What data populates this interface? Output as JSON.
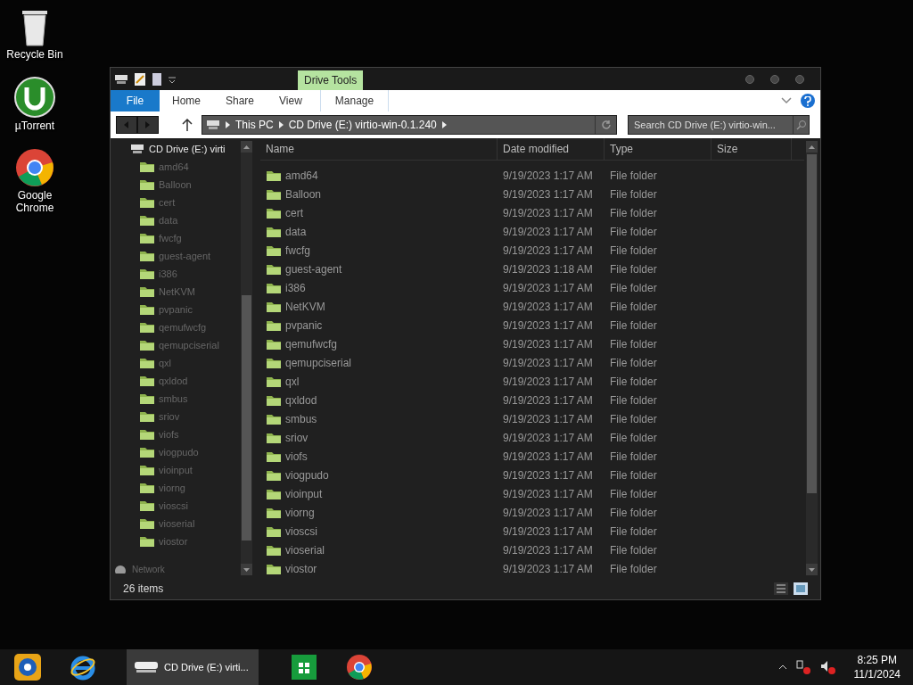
{
  "desktop_icons": [
    {
      "kind": "bin",
      "label": "Recycle Bin"
    },
    {
      "kind": "utorrent",
      "label": "µTorrent"
    },
    {
      "kind": "chrome",
      "label": "Google Chrome"
    }
  ],
  "window": {
    "ribbon_context": "Drive Tools",
    "tabs": [
      {
        "label": "File",
        "selected": false,
        "kind": "file"
      },
      {
        "label": "Home",
        "selected": false,
        "kind": "tab"
      },
      {
        "label": "Share",
        "selected": false,
        "kind": "tab"
      },
      {
        "label": "View",
        "selected": false,
        "kind": "tab"
      },
      {
        "label": "Manage",
        "selected": false,
        "kind": "context"
      }
    ],
    "breadcrumb": [
      "This PC",
      "CD Drive (E:) virtio-win-0.1.240"
    ],
    "search": {
      "placeholder": "Search CD Drive (E:) virtio-win..."
    },
    "nav": {
      "root": "CD Drive (E:) virti",
      "children": [
        "amd64",
        "Balloon",
        "cert",
        "data",
        "fwcfg",
        "guest-agent",
        "i386",
        "NetKVM",
        "pvpanic",
        "qemufwcfg",
        "qemupciserial",
        "qxl",
        "qxldod",
        "smbus",
        "sriov",
        "viofs",
        "viogpudo",
        "vioinput",
        "viorng",
        "vioscsi",
        "vioserial",
        "viostor"
      ],
      "network": "Network"
    },
    "columns": [
      "Name",
      "Date modified",
      "Type",
      "Size"
    ],
    "rows": [
      {
        "name": "amd64",
        "date": "9/19/2023 1:17 AM",
        "type": "File folder"
      },
      {
        "name": "Balloon",
        "date": "9/19/2023 1:17 AM",
        "type": "File folder"
      },
      {
        "name": "cert",
        "date": "9/19/2023 1:17 AM",
        "type": "File folder"
      },
      {
        "name": "data",
        "date": "9/19/2023 1:17 AM",
        "type": "File folder"
      },
      {
        "name": "fwcfg",
        "date": "9/19/2023 1:17 AM",
        "type": "File folder"
      },
      {
        "name": "guest-agent",
        "date": "9/19/2023 1:18 AM",
        "type": "File folder"
      },
      {
        "name": "i386",
        "date": "9/19/2023 1:17 AM",
        "type": "File folder"
      },
      {
        "name": "NetKVM",
        "date": "9/19/2023 1:17 AM",
        "type": "File folder"
      },
      {
        "name": "pvpanic",
        "date": "9/19/2023 1:17 AM",
        "type": "File folder"
      },
      {
        "name": "qemufwcfg",
        "date": "9/19/2023 1:17 AM",
        "type": "File folder"
      },
      {
        "name": "qemupciserial",
        "date": "9/19/2023 1:17 AM",
        "type": "File folder"
      },
      {
        "name": "qxl",
        "date": "9/19/2023 1:17 AM",
        "type": "File folder"
      },
      {
        "name": "qxldod",
        "date": "9/19/2023 1:17 AM",
        "type": "File folder"
      },
      {
        "name": "smbus",
        "date": "9/19/2023 1:17 AM",
        "type": "File folder"
      },
      {
        "name": "sriov",
        "date": "9/19/2023 1:17 AM",
        "type": "File folder"
      },
      {
        "name": "viofs",
        "date": "9/19/2023 1:17 AM",
        "type": "File folder"
      },
      {
        "name": "viogpudo",
        "date": "9/19/2023 1:17 AM",
        "type": "File folder"
      },
      {
        "name": "vioinput",
        "date": "9/19/2023 1:17 AM",
        "type": "File folder"
      },
      {
        "name": "viorng",
        "date": "9/19/2023 1:17 AM",
        "type": "File folder"
      },
      {
        "name": "vioscsi",
        "date": "9/19/2023 1:17 AM",
        "type": "File folder"
      },
      {
        "name": "vioserial",
        "date": "9/19/2023 1:17 AM",
        "type": "File folder"
      },
      {
        "name": "viostor",
        "date": "9/19/2023 1:17 AM",
        "type": "File folder"
      }
    ],
    "status": "26 items"
  },
  "taskbar": {
    "items": [
      {
        "kind": "media"
      },
      {
        "kind": "ie"
      },
      {
        "kind": "window",
        "label": "CD Drive (E:) virti...",
        "selected": true
      },
      {
        "kind": "store"
      },
      {
        "kind": "chrome"
      }
    ],
    "time": "8:25 PM",
    "date": "11/1/2024"
  }
}
